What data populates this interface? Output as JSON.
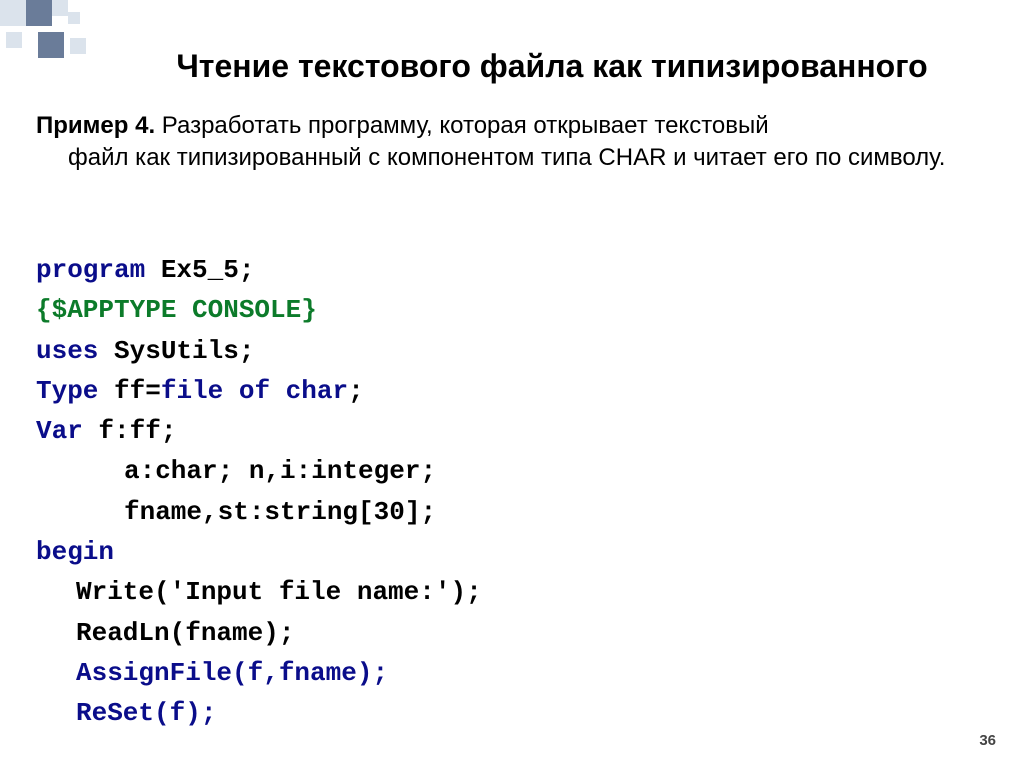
{
  "title": "Чтение текстового файла как типизированного",
  "example": {
    "lead": "Пример 4.",
    "line1_rest": " Разработать программу, которая открывает текстовый",
    "line2": "файл как типизированный с компонентом типа CHAR и читает его по символу."
  },
  "code": {
    "l1_kw": "program",
    "l1_rest": " Ex5_5;",
    "l2": "{$APPTYPE CONSOLE}",
    "l3_kw": "uses",
    "l3_rest": "  SysUtils;",
    "l4_kw1": "Type",
    "l4_mid": "  ff=",
    "l4_kw2": "file of char",
    "l4_semi": ";",
    "l5_kw": "Var",
    "l5_rest": "  f:ff;",
    "l6": "a:char;       n,i:integer;",
    "l7": "fname,st:string[30];",
    "l8": "begin",
    "l9": "Write('Input file name:');",
    "l10": "ReadLn(fname);",
    "l11": "AssignFile(f,fname);",
    "l12": "ReSet(f);"
  },
  "page_number": "36"
}
